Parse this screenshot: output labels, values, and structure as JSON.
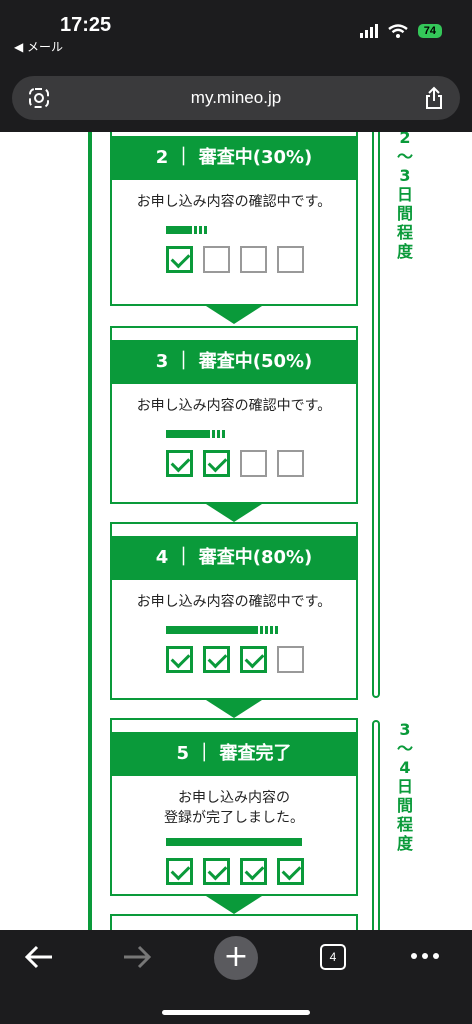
{
  "status": {
    "time": "17:25",
    "back": "◀ メール",
    "battery": "74"
  },
  "browser": {
    "url": "my.mineo.jp",
    "tab_count": "4"
  },
  "rails": [
    {
      "text": "2\n〜\n3\n日\n間\n程\n度"
    },
    {
      "text": "3\n〜\n4\n日\n間\n程\n度"
    }
  ],
  "steps": [
    {
      "title": "2 ｜ 審査中(30%)",
      "message": "お申し込み内容の確認中です。",
      "progress": 0.3,
      "checks": [
        true,
        false,
        false,
        false
      ]
    },
    {
      "title": "3 ｜ 審査中(50%)",
      "message": "お申し込み内容の確認中です。",
      "progress": 0.5,
      "checks": [
        true,
        true,
        false,
        false
      ]
    },
    {
      "title": "4 ｜ 審査中(80%)",
      "message": "お申し込み内容の確認中です。",
      "progress": 0.8,
      "checks": [
        true,
        true,
        true,
        false
      ]
    },
    {
      "title": "5 ｜ 審査完了",
      "message": "お申し込み内容の\n登録が完了しました。",
      "progress": 1.0,
      "checks": [
        true,
        true,
        true,
        true
      ]
    }
  ],
  "colors": {
    "accent": "#0a9a3a",
    "chrome": "#1c1c1e"
  },
  "icons": {
    "lens": "camera-lens-icon",
    "share": "share-icon",
    "back": "back-arrow-icon",
    "forward": "forward-arrow-icon",
    "new_tab": "plus-icon",
    "more": "more-dots-icon"
  }
}
